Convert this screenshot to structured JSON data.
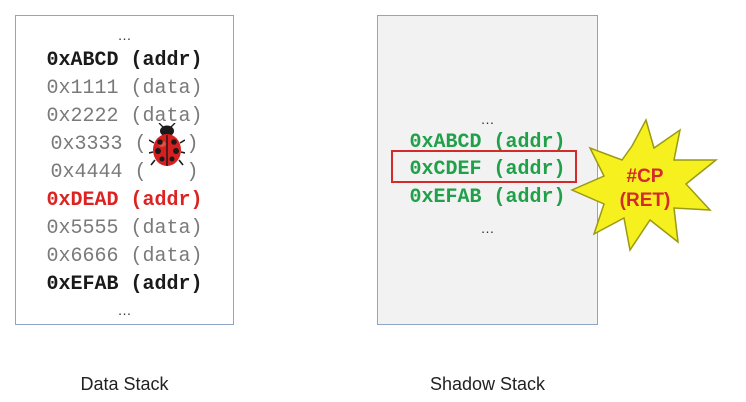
{
  "data_stack": {
    "caption": "Data Stack",
    "top_ellipsis": "…",
    "rows": [
      {
        "addr": "0xABCD",
        "tag": "(addr)"
      },
      {
        "addr": "0x1111",
        "tag": "(data)"
      },
      {
        "addr": "0x2222",
        "tag": "(data)"
      },
      {
        "addr": "0x3333",
        "tag_open": "(",
        "tag_close": ")",
        "icon": "ladybug-icon"
      },
      {
        "addr": "0x4444",
        "tag_open": "(",
        "tag_close": ")",
        "icon": "ladybug-icon"
      },
      {
        "addr": "0xDEAD",
        "tag": "(addr)"
      },
      {
        "addr": "0x5555",
        "tag": "(data)"
      },
      {
        "addr": "0x6666",
        "tag": "(data)"
      },
      {
        "addr": "0xEFAB",
        "tag": "(addr)"
      }
    ],
    "bottom_ellipsis": "…"
  },
  "shadow_stack": {
    "caption": "Shadow Stack",
    "top_ellipsis": "…",
    "rows": [
      {
        "addr": "0xABCD",
        "tag": "(addr)"
      },
      {
        "addr": "0xCDEF",
        "tag": "(addr)"
      },
      {
        "addr": "0xEFAB",
        "tag": "(addr)"
      }
    ],
    "bottom_ellipsis": "…"
  },
  "exception": {
    "line1": "#CP",
    "line2": "(RET)",
    "icon": "explosion-burst-icon"
  },
  "colors": {
    "return_address": "#1a1a1a",
    "corrupted": "#dd2222",
    "shadow_entry": "#21a04a",
    "burst_fill": "#f5f01e",
    "box_border": "#8ea6c6"
  }
}
